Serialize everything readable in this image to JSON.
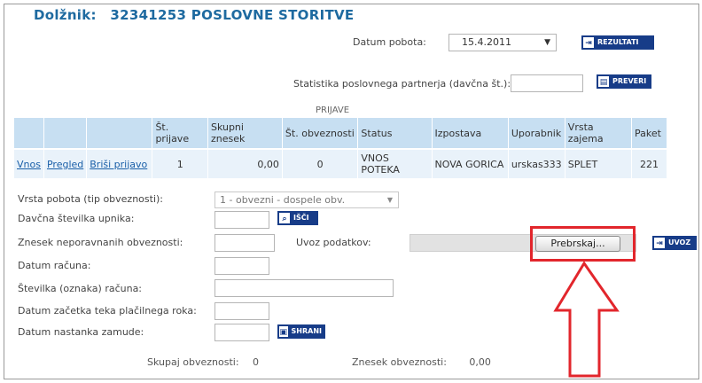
{
  "header": {
    "title_label": "Dolžnik:",
    "title_number": "32341253",
    "title_name": "POSLOVNE STORITVE"
  },
  "top_form": {
    "date_label": "Datum pobota:",
    "date_value": "15.4.2011",
    "results_button": "REZULTATI",
    "stats_label": "Statistika poslovnega partnerja (davčna št.):",
    "stats_value": "",
    "check_button": "PREVERI"
  },
  "table": {
    "caption": "PRIJAVE",
    "headers": [
      "",
      "",
      "",
      "Št. prijave",
      "Skupni znesek",
      "Št. obveznosti",
      "Status",
      "Izpostava",
      "Uporabnik",
      "Vrsta zajema",
      "Paket"
    ],
    "row": {
      "link_entry": "Vnos",
      "link_view": "Pregled",
      "link_delete": "Briši prijavo",
      "application_no": "1",
      "total_amount": "0,00",
      "obligations_count": "0",
      "status": "VNOS POTEKA",
      "branch": "NOVA GORICA",
      "user": "urskas333",
      "capture_type": "SPLET",
      "package": "221"
    }
  },
  "form": {
    "type_label": "Vrsta pobota (tip obveznosti):",
    "type_value": "1 - obvezni - dospele obv.",
    "tax_label": "Davčna številka upnika:",
    "search_button": "IŠČI",
    "amount_label": "Znesek neporavnanih obveznosti:",
    "import_label": "Uvoz podatkov:",
    "browse_button": "Prebrskaj...",
    "import_button": "UVOZ",
    "invoice_date_label": "Datum računa:",
    "invoice_number_label": "Številka (oznaka) računa:",
    "payment_start_label": "Datum začetka teka plačilnega roka:",
    "delay_date_label": "Datum nastanka zamude:",
    "save_button": "SHRANI"
  },
  "summary": {
    "obligations_label": "Skupaj obveznosti:",
    "obligations_value": "0",
    "amount_label": "Znesek obveznosti:",
    "amount_value": "0,00"
  },
  "colors": {
    "title": "#1e6aa0",
    "button": "#173c88",
    "table_header": "#c7dff2",
    "table_row": "#e9f2fa",
    "highlight": "#e2262c"
  }
}
